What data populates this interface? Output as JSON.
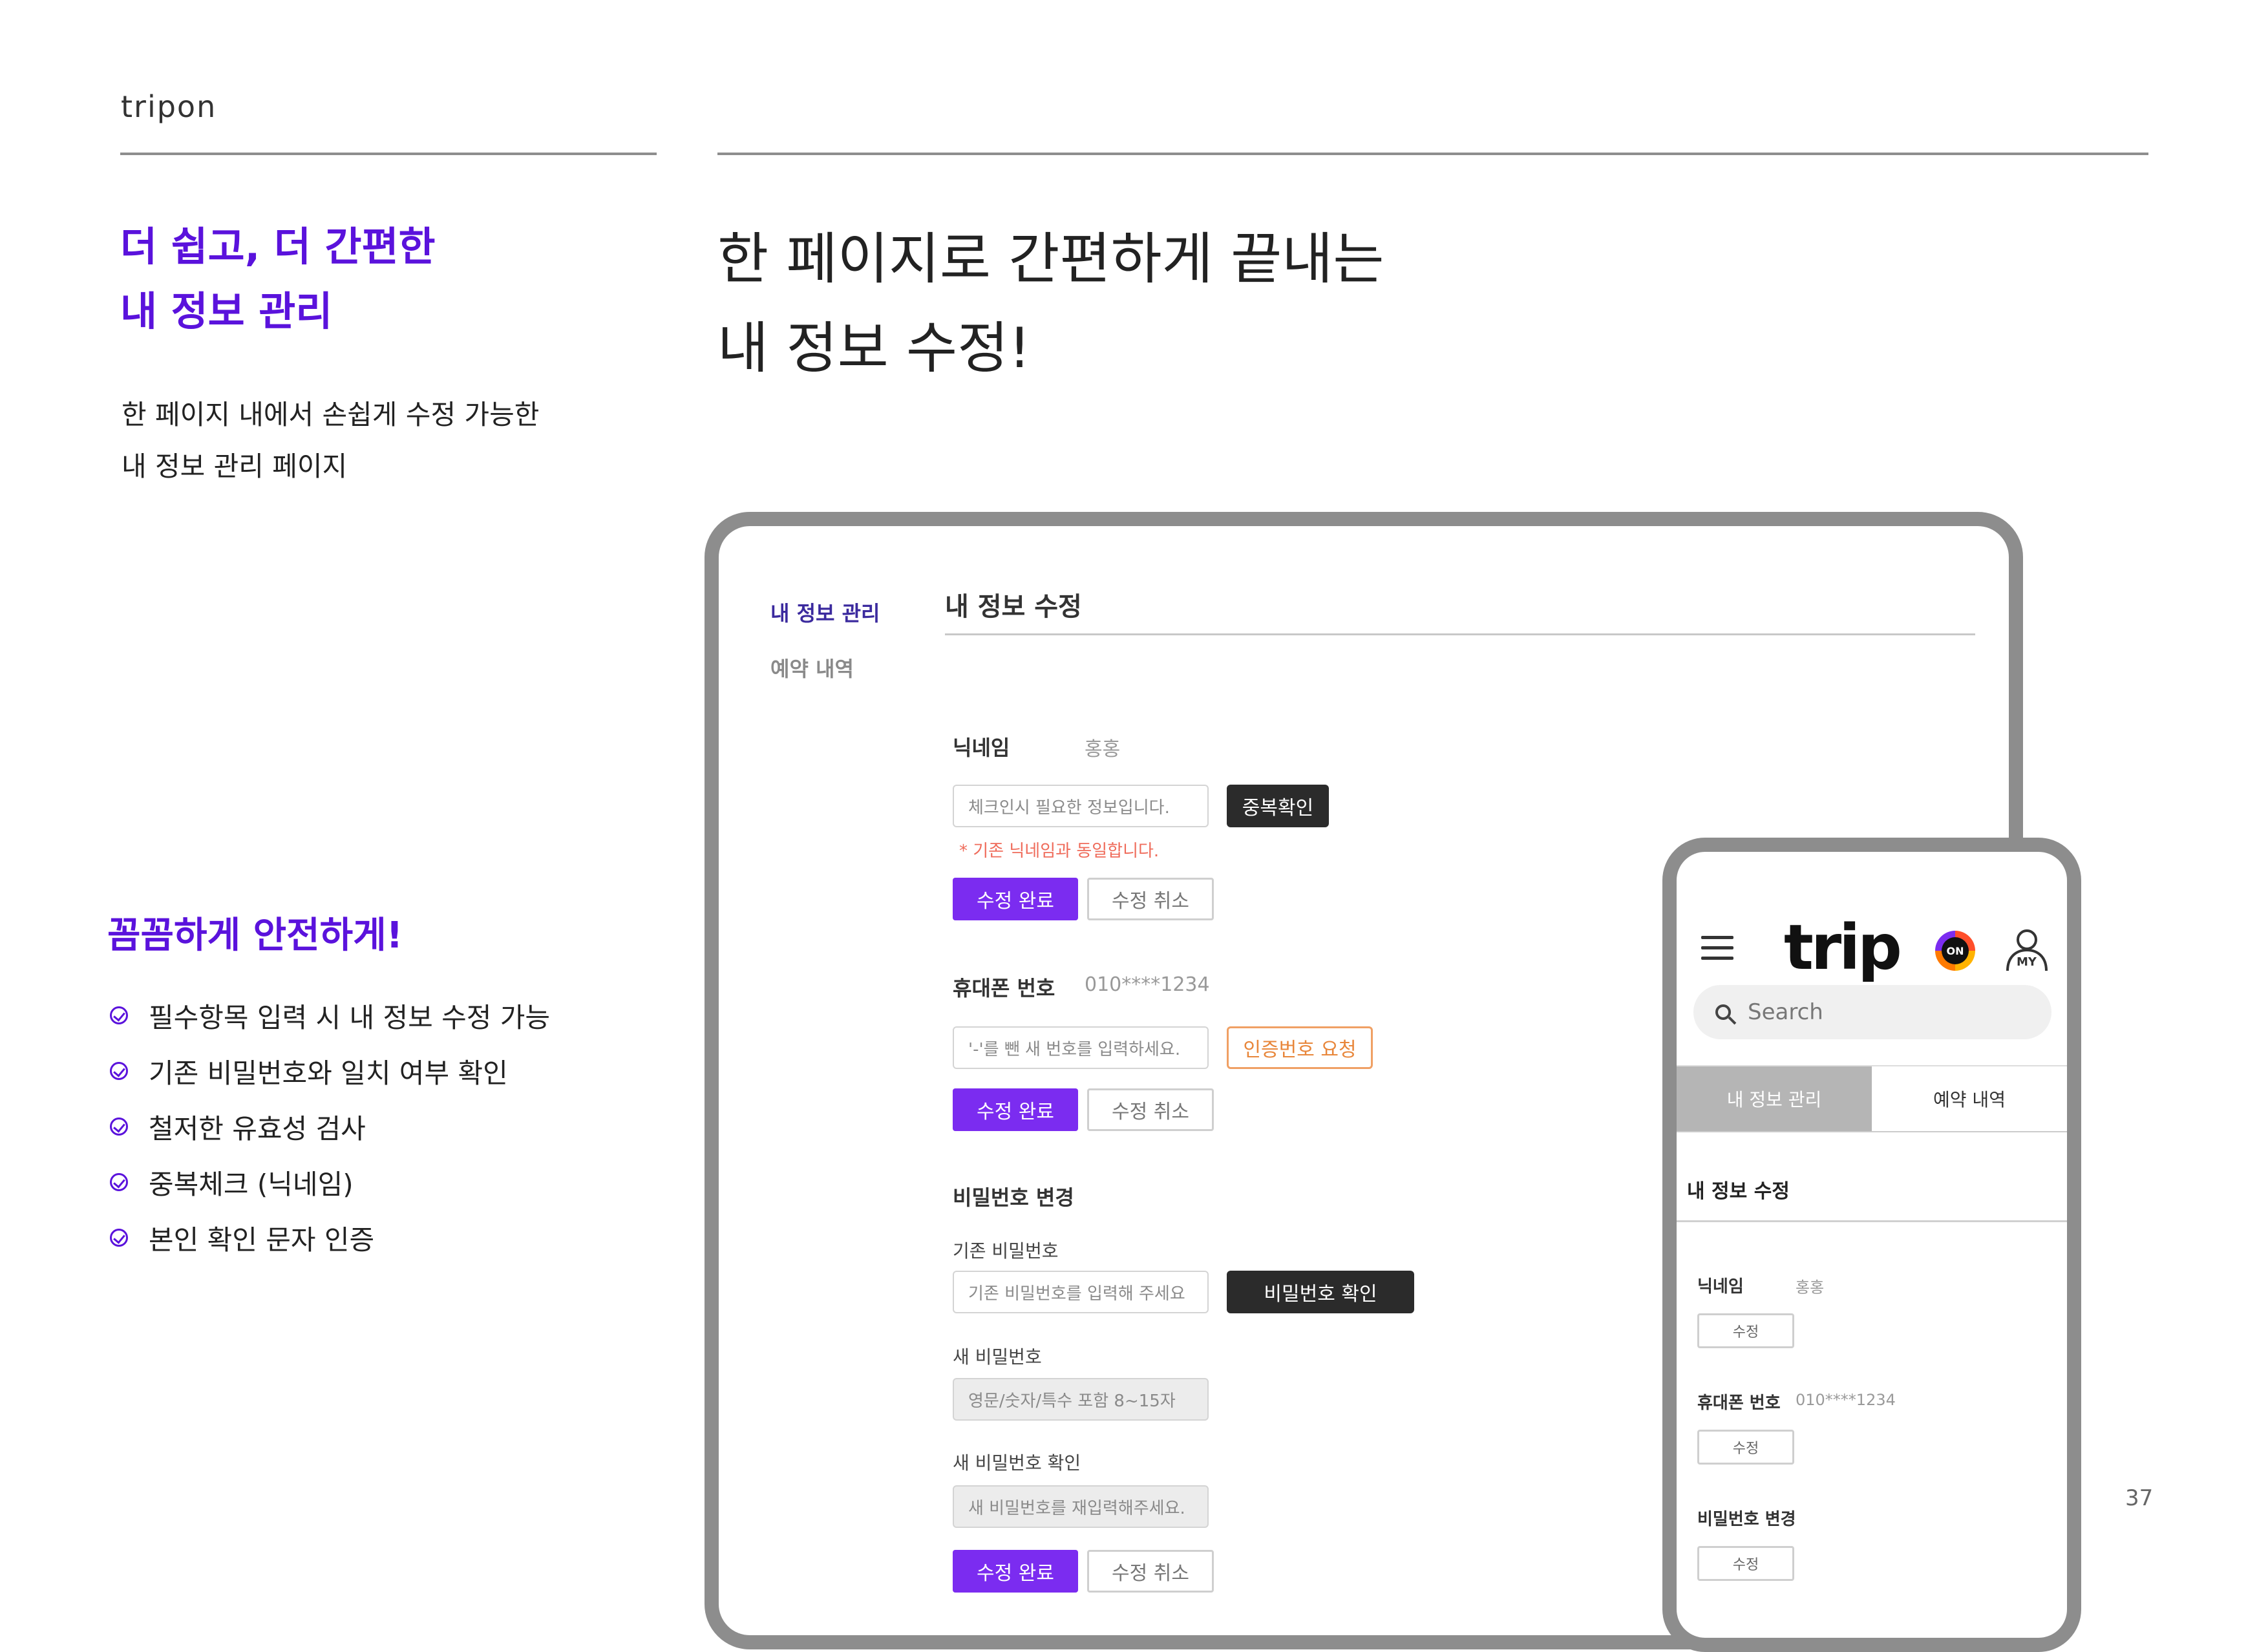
{
  "brand": "tripon",
  "left": {
    "title_line1": "더 쉽고, 더 간편한",
    "title_line2": "내 정보 관리",
    "sub_line1": "한 페이지 내에서 손쉽게 수정 가능한",
    "sub_line2": "내 정보 관리 페이지",
    "section_title": "꼼꼼하게 안전하게!",
    "checklist": [
      "필수항목 입력 시 내 정보 수정 가능",
      "기존 비밀번호와 일치 여부 확인",
      "철저한 유효성 검사",
      "중복체크 (닉네임)",
      "본인 확인 문자 인증"
    ]
  },
  "main": {
    "title_line1": "한 페이지로 간편하게 끝내는",
    "title_line2": "내 정보 수정!"
  },
  "desktop": {
    "nav": [
      "내 정보 관리",
      "예약 내역"
    ],
    "title": "내 정보 수정",
    "nickname": {
      "label": "닉네임",
      "value": "홍홍",
      "placeholder": "체크인시 필요한 정보입니다.",
      "check_button": "중복확인",
      "error": "* 기존 닉네임과 동일합니다."
    },
    "phone": {
      "label": "휴대폰 번호",
      "value": "010****1234",
      "placeholder": "'-'를 뺀 새 번호를 입력하세요.",
      "request_button": "인증번호 요청"
    },
    "password": {
      "label": "비밀번호 변경",
      "current_label": "기존 비밀번호",
      "current_placeholder": "기존 비밀번호를 입력해 주세요",
      "check_button": "비밀번호 확인",
      "new_label": "새 비밀번호",
      "new_placeholder": "영문/숫자/특수 포함 8~15자",
      "confirm_label": "새 비밀번호 확인",
      "confirm_placeholder": "새 비밀번호를 재입력해주세요."
    },
    "save_label": "수정 완료",
    "cancel_label": "수정 취소"
  },
  "mobile": {
    "logo": "trip",
    "logo_badge": "ON",
    "my_label": "MY",
    "search_placeholder": "Search",
    "tabs": [
      "내 정보 관리",
      "예약 내역"
    ],
    "title": "내 정보 수정",
    "nickname_label": "닉네임",
    "nickname_value": "홍홍",
    "phone_label": "휴대폰 번호",
    "phone_value": "010****1234",
    "password_label": "비밀번호 변경",
    "edit_label": "수정"
  },
  "page_number": "37",
  "colors": {
    "accent": "#5a12dc",
    "button": "#7b2cf0",
    "frame": "#8d8d8d"
  },
  "icons": [
    "check-circle-icon",
    "hamburger-icon",
    "search-icon",
    "my-user-icon"
  ]
}
